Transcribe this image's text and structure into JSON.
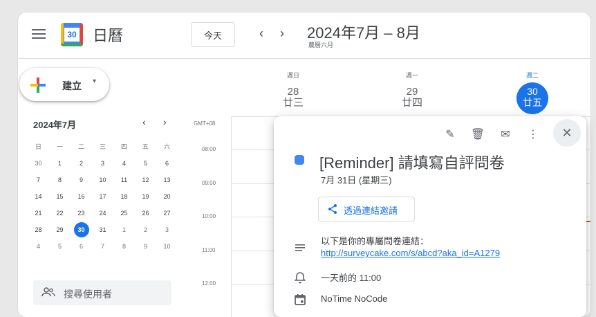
{
  "header": {
    "app_title": "日曆",
    "logo_day": "30",
    "today_label": "今天",
    "prev_icon": "chevron-left-icon",
    "next_icon": "chevron-right-icon",
    "prev_glyph": "‹",
    "next_glyph": "›",
    "month_range": "2024年7月 – 8月",
    "lunar_month": "農曆六月"
  },
  "sidebar": {
    "create_label": "建立",
    "create_caret": "▾",
    "mini_calendar": {
      "title": "2024年7月",
      "prev": "‹",
      "next": "›",
      "weekdays": [
        "日",
        "一",
        "二",
        "三",
        "四",
        "五",
        "六"
      ],
      "weeks": [
        [
          "30",
          "1",
          "2",
          "3",
          "4",
          "5",
          "6"
        ],
        [
          "7",
          "8",
          "9",
          "10",
          "11",
          "12",
          "13"
        ],
        [
          "14",
          "15",
          "16",
          "17",
          "18",
          "19",
          "20"
        ],
        [
          "21",
          "22",
          "23",
          "24",
          "25",
          "26",
          "27"
        ],
        [
          "28",
          "29",
          "30",
          "31",
          "1",
          "2",
          "3"
        ],
        [
          "4",
          "5",
          "6",
          "7",
          "8",
          "9",
          "10"
        ]
      ],
      "selected": "30"
    },
    "search_users_placeholder": "搜尋使用者"
  },
  "week": {
    "days": [
      {
        "name": "週日",
        "num": "28",
        "lunar": "廿三"
      },
      {
        "name": "週一",
        "num": "29",
        "lunar": "廿四"
      },
      {
        "name": "週二",
        "num": "30",
        "lunar": "廿五"
      }
    ],
    "timezone": "GMT+08",
    "times": [
      "08:00",
      "09:00",
      "10:00",
      "11:00",
      "12:00"
    ]
  },
  "event_popup": {
    "edit_glyph": "✎",
    "delete_glyph": "🗑",
    "email_glyph": "✉",
    "more_glyph": "⋮",
    "close_glyph": "✕",
    "title": "[Reminder] 請填寫自評問卷",
    "date": "7月 31日 (星期三)",
    "invite_label": "透過連結邀請",
    "description": "以下是你的專屬問卷連結：",
    "link": "http://surveycake.com/s/abcd?aka_id=A1279",
    "reminder": "一天前的 11:00",
    "calendar_name": "NoTime NoCode",
    "color": "#4285f4"
  }
}
